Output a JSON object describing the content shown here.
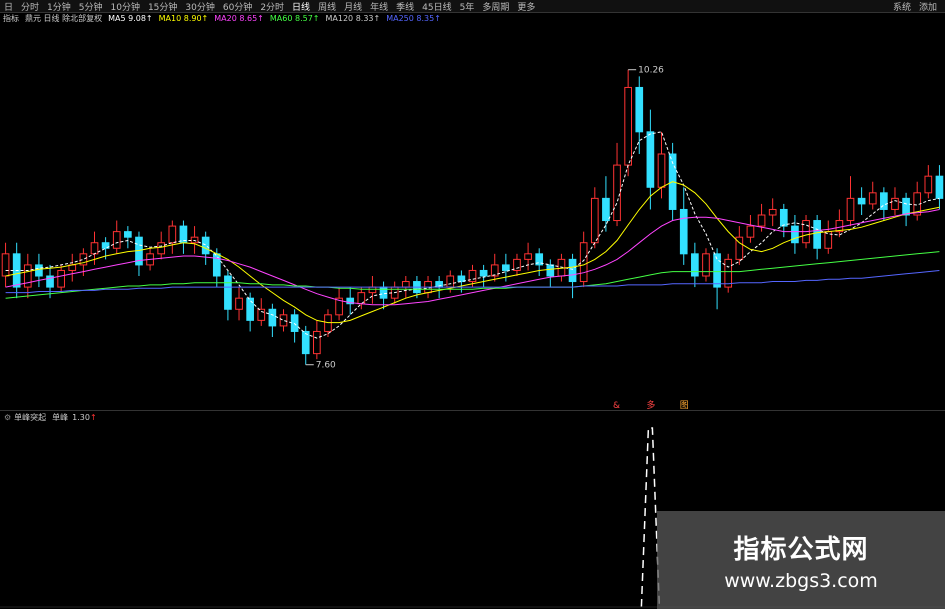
{
  "toolbar": {
    "items": [
      "日",
      "分时",
      "1分钟",
      "5分钟",
      "10分钟",
      "15分钟",
      "30分钟",
      "60分钟",
      "2分时",
      "日线",
      "周线",
      "月线",
      "年线",
      "季线",
      "45日线",
      "5年",
      "多周期",
      "更多"
    ],
    "active_index": 9,
    "right": [
      "系统",
      "添加"
    ]
  },
  "infobar": {
    "items": [
      {
        "text": "指标",
        "color": "#cccccc"
      },
      {
        "text": "鼎元 日线 除北部复权",
        "color": "#cccccc"
      },
      {
        "text": "MA5 9.08↑",
        "color": "#ffffff"
      },
      {
        "text": "MA10 8.90↑",
        "color": "#ffff00"
      },
      {
        "text": "MA20 8.65↑",
        "color": "#ff44ff"
      },
      {
        "text": "MA60 8.57↑",
        "color": "#44ff44"
      },
      {
        "text": "MA120 8.33↑",
        "color": "#cccccc"
      },
      {
        "text": "MA250 8.35↑",
        "color": "#5566ff"
      }
    ]
  },
  "sub_info": {
    "name": "单峰突起",
    "value_label": "单峰",
    "value": "1.30"
  },
  "watermark": {
    "title": "指标公式网",
    "url": "www.zbgs3.com"
  },
  "colors": {
    "up": "#ff3333",
    "down": "#33e0ff",
    "ma5": "#ffffff",
    "ma10": "#ffff00",
    "ma20": "#ff44ff",
    "ma60": "#44ff44",
    "ma250": "#5566ff"
  },
  "chart_data": {
    "type": "candlestick",
    "price_range": [
      7.3,
      10.6
    ],
    "high_label": "10.26",
    "low_label": "7.60",
    "candles": [
      [
        8.4,
        8.6,
        8.3,
        8.7
      ],
      [
        8.6,
        8.3,
        8.2,
        8.7
      ],
      [
        8.3,
        8.5,
        8.2,
        8.6
      ],
      [
        8.5,
        8.4,
        8.3,
        8.6
      ],
      [
        8.4,
        8.3,
        8.2,
        8.5
      ],
      [
        8.3,
        8.45,
        8.25,
        8.5
      ],
      [
        8.45,
        8.5,
        8.35,
        8.6
      ],
      [
        8.5,
        8.6,
        8.4,
        8.65
      ],
      [
        8.6,
        8.7,
        8.5,
        8.8
      ],
      [
        8.7,
        8.65,
        8.55,
        8.75
      ],
      [
        8.65,
        8.8,
        8.6,
        8.9
      ],
      [
        8.8,
        8.75,
        8.65,
        8.85
      ],
      [
        8.75,
        8.5,
        8.4,
        8.8
      ],
      [
        8.5,
        8.6,
        8.45,
        8.65
      ],
      [
        8.6,
        8.7,
        8.55,
        8.8
      ],
      [
        8.7,
        8.85,
        8.6,
        8.9
      ],
      [
        8.85,
        8.7,
        8.6,
        8.9
      ],
      [
        8.7,
        8.75,
        8.6,
        8.85
      ],
      [
        8.75,
        8.6,
        8.5,
        8.8
      ],
      [
        8.6,
        8.4,
        8.3,
        8.65
      ],
      [
        8.4,
        8.1,
        8.0,
        8.45
      ],
      [
        8.1,
        8.2,
        8.0,
        8.3
      ],
      [
        8.2,
        8.0,
        7.9,
        8.25
      ],
      [
        8.0,
        8.1,
        7.95,
        8.2
      ],
      [
        8.1,
        7.95,
        7.85,
        8.15
      ],
      [
        7.95,
        8.05,
        7.9,
        8.1
      ],
      [
        8.05,
        7.9,
        7.8,
        8.1
      ],
      [
        7.9,
        7.7,
        7.6,
        7.95
      ],
      [
        7.7,
        7.9,
        7.65,
        8.0
      ],
      [
        7.9,
        8.05,
        7.85,
        8.1
      ],
      [
        8.05,
        8.2,
        8.0,
        8.3
      ],
      [
        8.2,
        8.15,
        8.05,
        8.3
      ],
      [
        8.15,
        8.25,
        8.1,
        8.3
      ],
      [
        8.25,
        8.3,
        8.15,
        8.4
      ],
      [
        8.3,
        8.2,
        8.1,
        8.35
      ],
      [
        8.2,
        8.3,
        8.15,
        8.35
      ],
      [
        8.3,
        8.35,
        8.2,
        8.4
      ],
      [
        8.35,
        8.25,
        8.2,
        8.4
      ],
      [
        8.25,
        8.35,
        8.2,
        8.4
      ],
      [
        8.35,
        8.3,
        8.2,
        8.4
      ],
      [
        8.3,
        8.4,
        8.25,
        8.45
      ],
      [
        8.4,
        8.35,
        8.25,
        8.45
      ],
      [
        8.35,
        8.45,
        8.3,
        8.5
      ],
      [
        8.45,
        8.4,
        8.3,
        8.5
      ],
      [
        8.4,
        8.5,
        8.35,
        8.6
      ],
      [
        8.5,
        8.45,
        8.35,
        8.6
      ],
      [
        8.45,
        8.55,
        8.4,
        8.6
      ],
      [
        8.55,
        8.6,
        8.45,
        8.7
      ],
      [
        8.6,
        8.5,
        8.4,
        8.65
      ],
      [
        8.5,
        8.4,
        8.3,
        8.55
      ],
      [
        8.4,
        8.55,
        8.35,
        8.6
      ],
      [
        8.55,
        8.35,
        8.2,
        8.6
      ],
      [
        8.35,
        8.7,
        8.3,
        8.8
      ],
      [
        8.7,
        9.1,
        8.65,
        9.2
      ],
      [
        9.1,
        8.9,
        8.8,
        9.3
      ],
      [
        8.9,
        9.4,
        8.85,
        9.6
      ],
      [
        9.4,
        10.1,
        9.3,
        10.26
      ],
      [
        10.1,
        9.7,
        9.5,
        10.2
      ],
      [
        9.7,
        9.2,
        9.0,
        9.9
      ],
      [
        9.2,
        9.5,
        9.1,
        9.7
      ],
      [
        9.5,
        9.0,
        8.9,
        9.6
      ],
      [
        9.0,
        8.6,
        8.5,
        9.2
      ],
      [
        8.6,
        8.4,
        8.3,
        8.7
      ],
      [
        8.4,
        8.6,
        8.35,
        8.65
      ],
      [
        8.6,
        8.3,
        8.1,
        8.65
      ],
      [
        8.3,
        8.55,
        8.25,
        8.6
      ],
      [
        8.55,
        8.75,
        8.5,
        8.85
      ],
      [
        8.75,
        8.85,
        8.7,
        8.95
      ],
      [
        8.85,
        8.95,
        8.8,
        9.05
      ],
      [
        8.95,
        9.0,
        8.85,
        9.1
      ],
      [
        9.0,
        8.85,
        8.75,
        9.05
      ],
      [
        8.85,
        8.7,
        8.6,
        8.95
      ],
      [
        8.7,
        8.9,
        8.65,
        8.95
      ],
      [
        8.9,
        8.65,
        8.55,
        8.95
      ],
      [
        8.65,
        8.8,
        8.6,
        8.9
      ],
      [
        8.8,
        8.9,
        8.75,
        9.0
      ],
      [
        8.9,
        9.1,
        8.85,
        9.3
      ],
      [
        9.1,
        9.05,
        8.95,
        9.2
      ],
      [
        9.05,
        9.15,
        9.0,
        9.25
      ],
      [
        9.15,
        9.0,
        8.9,
        9.2
      ],
      [
        9.0,
        9.1,
        8.95,
        9.2
      ],
      [
        9.1,
        8.95,
        8.85,
        9.15
      ],
      [
        8.95,
        9.15,
        8.9,
        9.25
      ],
      [
        9.15,
        9.3,
        9.1,
        9.4
      ],
      [
        9.3,
        9.1,
        9.0,
        9.4
      ]
    ],
    "ma_lines": [
      {
        "key": "ma5",
        "values": [
          8.45,
          8.45,
          8.45,
          8.47,
          8.48,
          8.5,
          8.52,
          8.55,
          8.6,
          8.65,
          8.7,
          8.72,
          8.68,
          8.66,
          8.67,
          8.7,
          8.72,
          8.72,
          8.68,
          8.58,
          8.45,
          8.32,
          8.18,
          8.08,
          8.05,
          8.0,
          7.97,
          7.88,
          7.84,
          7.88,
          7.95,
          8.05,
          8.15,
          8.22,
          8.24,
          8.25,
          8.27,
          8.28,
          8.29,
          8.31,
          8.33,
          8.35,
          8.37,
          8.39,
          8.41,
          8.44,
          8.47,
          8.5,
          8.52,
          8.5,
          8.48,
          8.46,
          8.54,
          8.7,
          8.86,
          9.06,
          9.4,
          9.62,
          9.68,
          9.7,
          9.42,
          9.22,
          8.96,
          8.78,
          8.55,
          8.48,
          8.53,
          8.62,
          8.7,
          8.8,
          8.86,
          8.88,
          8.86,
          8.82,
          8.78,
          8.77,
          8.82,
          8.88,
          8.96,
          9.04,
          9.08,
          9.05,
          9.04,
          9.08,
          9.1
        ]
      },
      {
        "key": "ma10",
        "values": [
          8.4,
          8.42,
          8.44,
          8.46,
          8.47,
          8.48,
          8.5,
          8.52,
          8.55,
          8.58,
          8.6,
          8.62,
          8.63,
          8.65,
          8.66,
          8.68,
          8.7,
          8.69,
          8.65,
          8.6,
          8.55,
          8.48,
          8.4,
          8.32,
          8.25,
          8.18,
          8.12,
          8.05,
          8.0,
          7.98,
          7.98,
          8.0,
          8.04,
          8.08,
          8.12,
          8.16,
          8.2,
          8.23,
          8.25,
          8.27,
          8.29,
          8.31,
          8.33,
          8.35,
          8.37,
          8.39,
          8.41,
          8.43,
          8.45,
          8.46,
          8.47,
          8.48,
          8.5,
          8.55,
          8.62,
          8.72,
          8.86,
          9.0,
          9.12,
          9.2,
          9.25,
          9.22,
          9.15,
          9.05,
          8.92,
          8.8,
          8.7,
          8.64,
          8.62,
          8.65,
          8.7,
          8.74,
          8.77,
          8.79,
          8.8,
          8.81,
          8.82,
          8.84,
          8.87,
          8.9,
          8.93,
          8.96,
          8.98,
          9.0,
          9.02
        ]
      },
      {
        "key": "ma20",
        "values": [
          8.3,
          8.32,
          8.34,
          8.36,
          8.38,
          8.4,
          8.42,
          8.44,
          8.46,
          8.48,
          8.5,
          8.52,
          8.54,
          8.55,
          8.56,
          8.57,
          8.58,
          8.58,
          8.57,
          8.56,
          8.54,
          8.51,
          8.48,
          8.44,
          8.4,
          8.36,
          8.32,
          8.28,
          8.24,
          8.21,
          8.18,
          8.16,
          8.15,
          8.14,
          8.14,
          8.14,
          8.15,
          8.16,
          8.17,
          8.19,
          8.21,
          8.23,
          8.25,
          8.27,
          8.29,
          8.31,
          8.33,
          8.35,
          8.37,
          8.39,
          8.4,
          8.41,
          8.43,
          8.46,
          8.5,
          8.55,
          8.62,
          8.7,
          8.78,
          8.85,
          8.9,
          8.92,
          8.93,
          8.93,
          8.92,
          8.9,
          8.88,
          8.86,
          8.84,
          8.82,
          8.8,
          8.8,
          8.8,
          8.81,
          8.82,
          8.84,
          8.86,
          8.88,
          8.9,
          8.92,
          8.94,
          8.96,
          8.97,
          8.98,
          9.0
        ]
      },
      {
        "key": "ma60",
        "values": [
          8.2,
          8.21,
          8.22,
          8.23,
          8.24,
          8.25,
          8.26,
          8.27,
          8.28,
          8.29,
          8.3,
          8.31,
          8.31,
          8.32,
          8.32,
          8.33,
          8.33,
          8.34,
          8.34,
          8.34,
          8.34,
          8.34,
          8.33,
          8.33,
          8.32,
          8.32,
          8.31,
          8.31,
          8.3,
          8.3,
          8.29,
          8.29,
          8.28,
          8.28,
          8.28,
          8.28,
          8.28,
          8.28,
          8.28,
          8.28,
          8.28,
          8.28,
          8.28,
          8.29,
          8.29,
          8.29,
          8.3,
          8.3,
          8.3,
          8.3,
          8.3,
          8.3,
          8.31,
          8.32,
          8.33,
          8.35,
          8.37,
          8.39,
          8.41,
          8.43,
          8.44,
          8.44,
          8.44,
          8.44,
          8.44,
          8.44,
          8.44,
          8.45,
          8.46,
          8.47,
          8.48,
          8.49,
          8.5,
          8.51,
          8.52,
          8.53,
          8.54,
          8.55,
          8.56,
          8.57,
          8.58,
          8.59,
          8.6,
          8.61,
          8.62
        ]
      },
      {
        "key": "ma250",
        "values": [
          8.25,
          8.25,
          8.25,
          8.26,
          8.26,
          8.26,
          8.27,
          8.27,
          8.27,
          8.28,
          8.28,
          8.28,
          8.29,
          8.29,
          8.29,
          8.3,
          8.3,
          8.3,
          8.3,
          8.3,
          8.3,
          8.3,
          8.3,
          8.3,
          8.3,
          8.3,
          8.3,
          8.3,
          8.3,
          8.3,
          8.3,
          8.3,
          8.3,
          8.3,
          8.3,
          8.3,
          8.3,
          8.3,
          8.3,
          8.3,
          8.3,
          8.3,
          8.3,
          8.3,
          8.3,
          8.3,
          8.3,
          8.3,
          8.3,
          8.3,
          8.3,
          8.3,
          8.31,
          8.31,
          8.31,
          8.31,
          8.32,
          8.32,
          8.32,
          8.32,
          8.33,
          8.33,
          8.33,
          8.33,
          8.33,
          8.33,
          8.34,
          8.34,
          8.34,
          8.35,
          8.35,
          8.35,
          8.36,
          8.36,
          8.37,
          8.37,
          8.38,
          8.38,
          8.39,
          8.4,
          8.41,
          8.42,
          8.43,
          8.44,
          8.45
        ]
      }
    ],
    "signals": [
      {
        "index": 55,
        "text": "&"
      },
      {
        "index": 58,
        "text": "多"
      },
      {
        "index": 61,
        "text": "图"
      }
    ],
    "sub_indicator": {
      "name": "单峰",
      "spike_index": 58,
      "spike_value": 1.3,
      "range": [
        0,
        1.3
      ]
    }
  }
}
